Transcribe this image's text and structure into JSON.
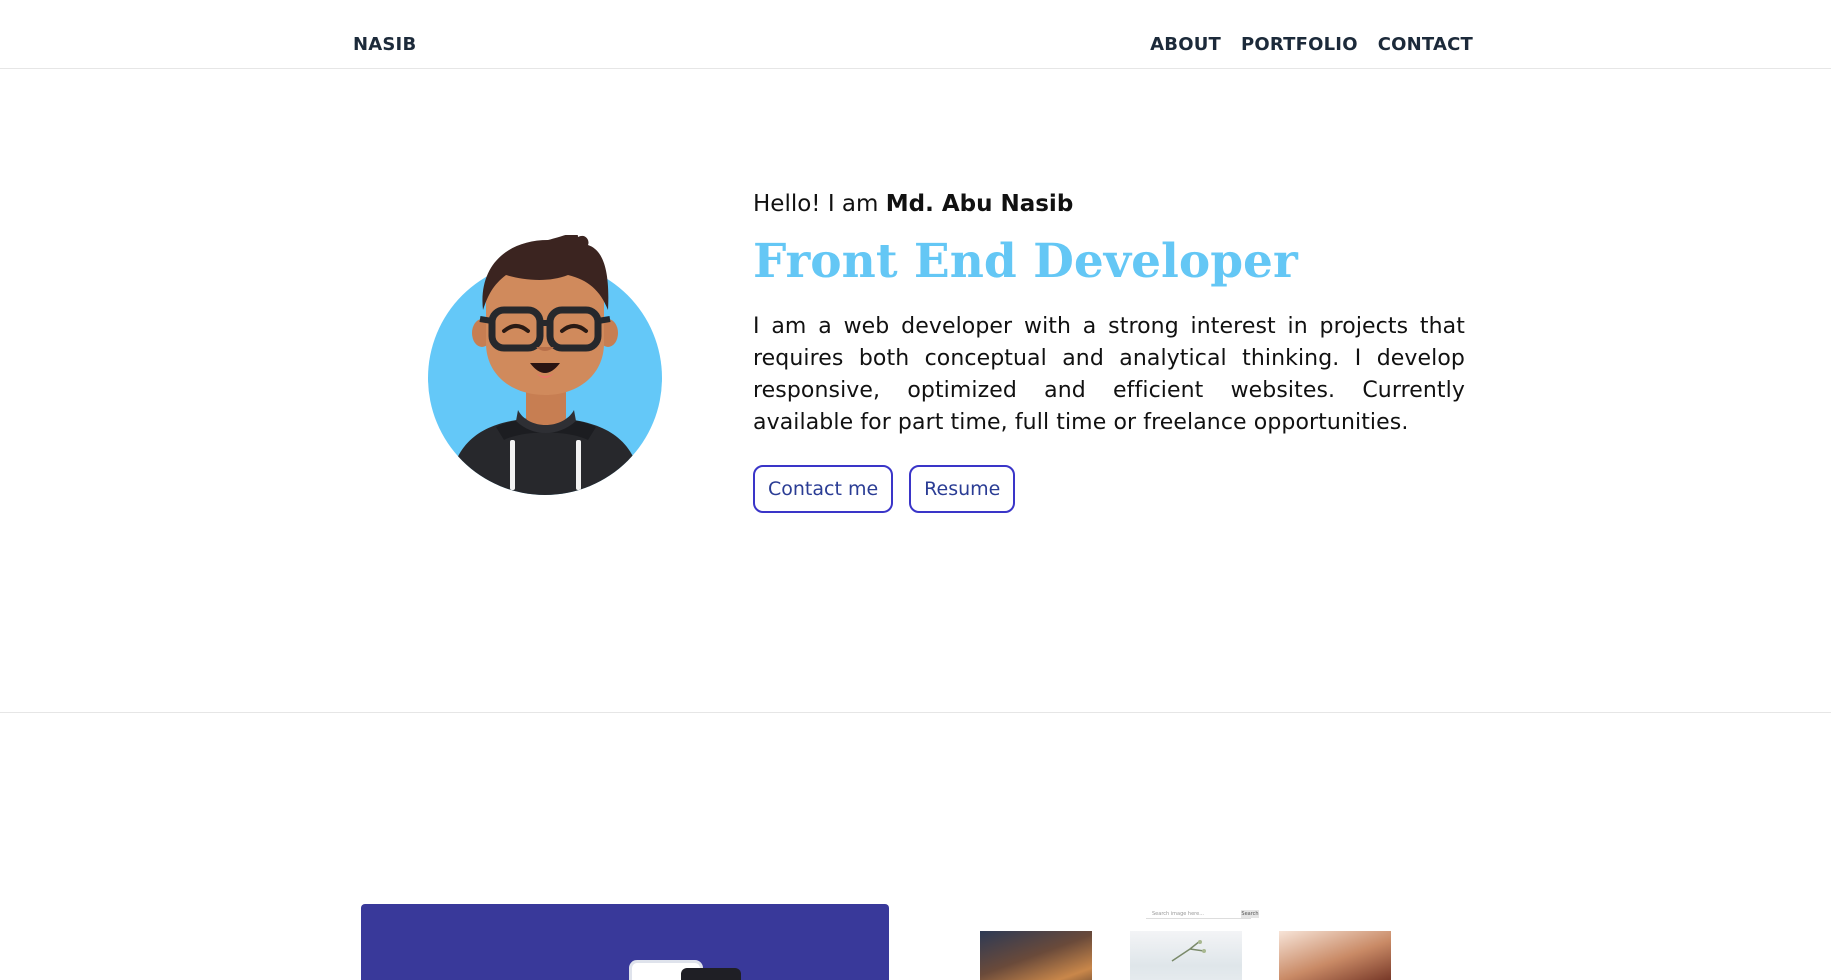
{
  "nav": {
    "brand": "NASIB",
    "links": [
      "ABOUT",
      "PORTFOLIO",
      "CONTACT"
    ]
  },
  "hero": {
    "greeting_prefix": "Hello! I am ",
    "name": "Md. Abu Nasib",
    "role": "Front End Developer",
    "bio": "I am a web developer with a strong interest in projects that requires both conceptual and analytical thinking. I develop responsive, optimized and efficient websites. Currently available for part time, full time or freelance opportunities.",
    "buttons": [
      "Contact me",
      "Resume"
    ],
    "avatar_icon": "developer-avatar-icon"
  },
  "portfolio": {
    "gallery_search_placeholder": "Search image here...",
    "gallery_search_button": "Search"
  },
  "colors": {
    "accent": "#64c7f5",
    "button_border": "#3a35c8",
    "button_text": "#2a3c94",
    "card_dark": "#39399a"
  }
}
